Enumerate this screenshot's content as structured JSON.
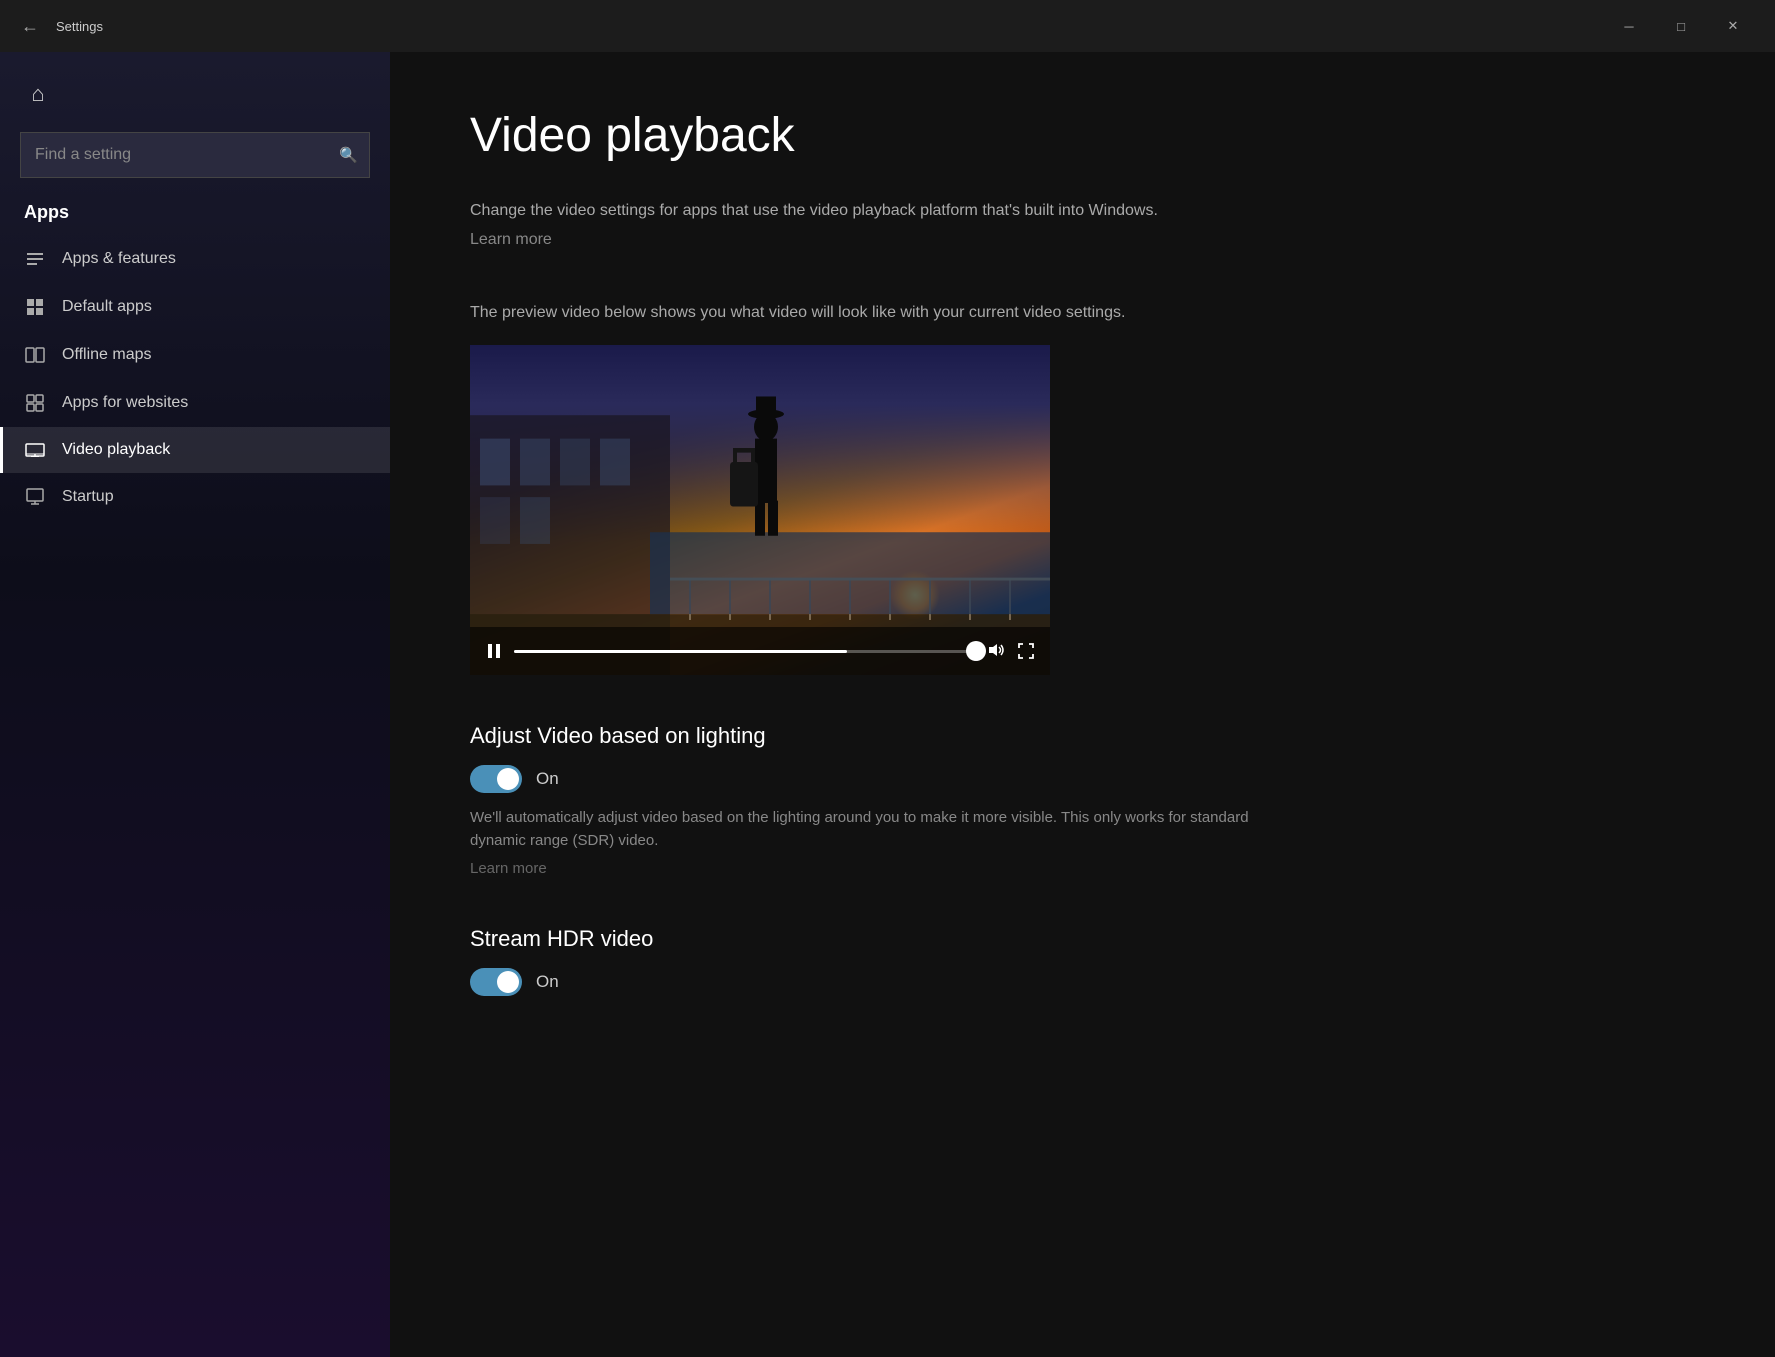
{
  "titleBar": {
    "back_label": "←",
    "title": "Settings",
    "minimize": "─",
    "maximize": "□",
    "close": "✕"
  },
  "sidebar": {
    "home_icon": "⌂",
    "search_placeholder": "Find a setting",
    "search_icon": "🔍",
    "section_title": "Apps",
    "items": [
      {
        "id": "apps-features",
        "label": "Apps & features",
        "icon": "☰"
      },
      {
        "id": "default-apps",
        "label": "Default apps",
        "icon": "⊞"
      },
      {
        "id": "offline-maps",
        "label": "Offline maps",
        "icon": "◫"
      },
      {
        "id": "apps-websites",
        "label": "Apps for websites",
        "icon": "⊡"
      },
      {
        "id": "video-playback",
        "label": "Video playback",
        "icon": "▭",
        "active": true
      },
      {
        "id": "startup",
        "label": "Startup",
        "icon": "⬚"
      }
    ]
  },
  "content": {
    "page_title": "Video playback",
    "description": "Change the video settings for apps that use the video playback platform that's built into Windows.",
    "learn_more_1": "Learn more",
    "preview_description": "The preview video below shows you what video will look like with your current video settings.",
    "video": {
      "pause_icon": "⏸",
      "volume_icon": "🔊",
      "fullscreen_icon": "⤢",
      "progress_percent": 72
    },
    "adjust_lighting": {
      "title": "Adjust Video based on lighting",
      "toggle_state": "On",
      "description": "We'll automatically adjust video based on the lighting around you to make it more visible. This only works for standard dynamic range (SDR) video.",
      "learn_more": "Learn more"
    },
    "stream_hdr": {
      "title": "Stream HDR video",
      "toggle_state": "On"
    }
  }
}
